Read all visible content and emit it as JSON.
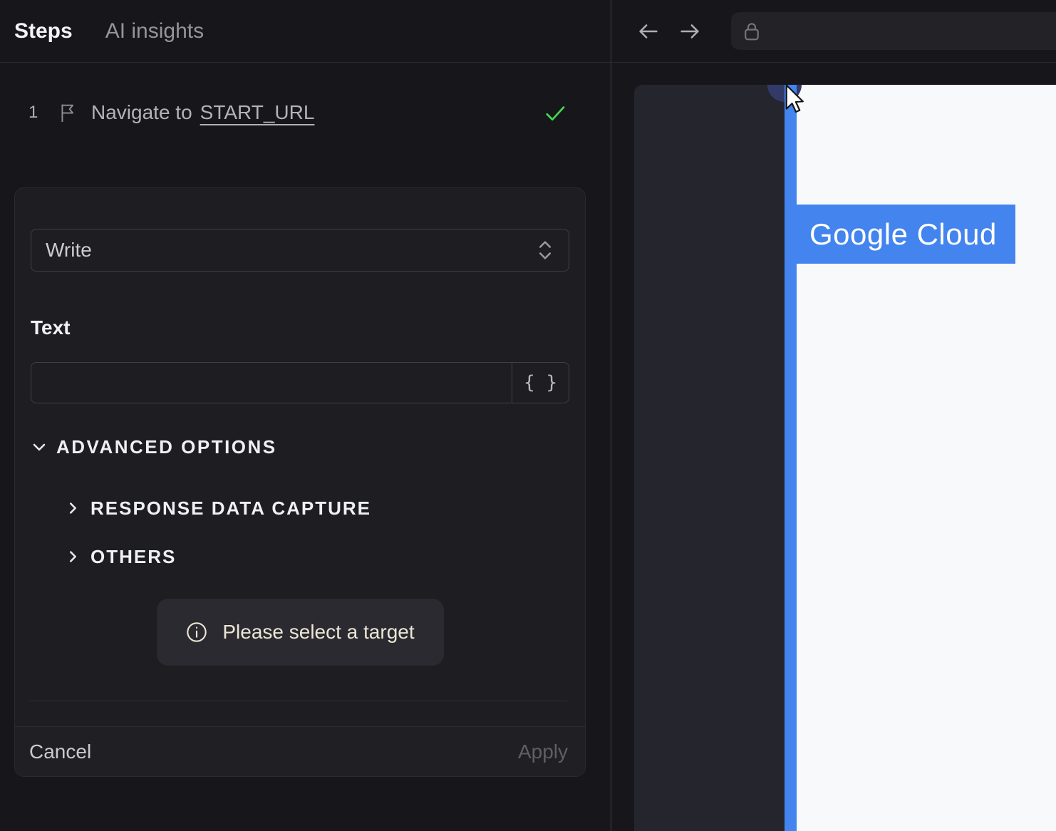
{
  "colors": {
    "accent_blue": "#4384ee",
    "success_green": "#45d94f",
    "hint_text": "#ece6d6",
    "panel_bg": "#17171b",
    "card_bg": "#1d1d22",
    "page_bg": "#f8f9fa"
  },
  "left_panel": {
    "tabs": [
      {
        "label": "Steps",
        "active": true
      },
      {
        "label": "AI insights",
        "active": false
      }
    ],
    "step": {
      "number": "1",
      "icon": "flag-icon",
      "title_prefix": "Navigate to",
      "title_link": "START_URL",
      "status_icon": "check-icon",
      "status": "success"
    },
    "editor": {
      "action_select": {
        "value": "Write",
        "icon": "chevron-up-down-icon"
      },
      "text_field": {
        "label": "Text",
        "value": "",
        "variable_button_label": "{ }"
      },
      "advanced": {
        "label": "ADVANCED OPTIONS",
        "icon": "chevron-down-icon",
        "sections": [
          {
            "label": "RESPONSE DATA CAPTURE",
            "icon": "chevron-right-icon"
          },
          {
            "label": "OTHERS",
            "icon": "chevron-right-icon"
          }
        ]
      },
      "hint": {
        "icon": "info-icon",
        "text": "Please select a target"
      },
      "footer": {
        "cancel_label": "Cancel",
        "apply_label": "Apply",
        "apply_enabled": false
      }
    }
  },
  "browser_panel": {
    "toolbar": {
      "back_icon": "arrow-left-icon",
      "forward_icon": "arrow-right-icon",
      "address_bar": {
        "lock_icon": "lock-icon",
        "value": ""
      }
    },
    "page": {
      "highlight_label": "Google Cloud",
      "cursor_icon": "pointer-cursor-icon",
      "selection_rail": "element-selection-rail"
    }
  }
}
